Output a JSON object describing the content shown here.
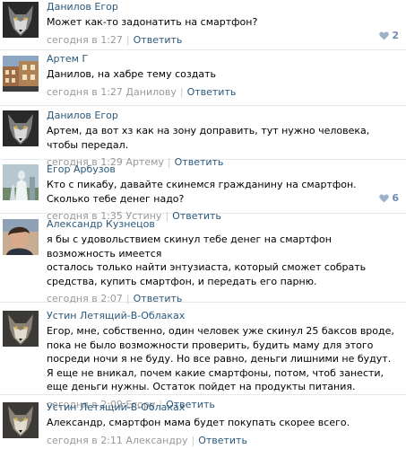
{
  "colors": {
    "link": "#2b587a",
    "meta": "#999999",
    "like": "#9db1c8",
    "divider": "#e7e8ec"
  },
  "comments": [
    {
      "author": "Данилов Егор",
      "avatar": "wolf-avatar",
      "lines": [
        "Может как-то задонатить на смартфон?"
      ],
      "time": "сегодня в 1:27",
      "reply_to": "",
      "reply_label": "Ответить",
      "likes": "2"
    },
    {
      "author": "Артем Г",
      "avatar": "building-avatar",
      "lines": [
        "Данилов, на хабре тему создать"
      ],
      "time": "сегодня в 1:27",
      "reply_to": "Данилову",
      "reply_label": "Ответить",
      "likes": ""
    },
    {
      "author": "Данилов Егор",
      "avatar": "wolf-avatar",
      "lines": [
        "Артем, да вот хз как на зону доправить, тут нужно человека, чтобы передал."
      ],
      "time": "сегодня в 1:29",
      "reply_to": "Артему",
      "reply_label": "Ответить",
      "likes": ""
    },
    {
      "author": "Егор Арбузов",
      "avatar": "statue-avatar",
      "lines": [
        "Кто с пикабу, давайте скинемся гражданину на смартфон. Сколько тебе денег надо?"
      ],
      "time": "сегодня в 1:35",
      "reply_to": "Устину",
      "reply_label": "Ответить",
      "likes": "6"
    },
    {
      "author": "Александр Кузнецов",
      "avatar": "person-avatar",
      "lines": [
        "я бы с удовольствием скинул тебе денег на смартфон",
        "возможность имеется",
        "осталось только найти энтузиаста, который сможет собрать средства, купить смартфон, и передать его парню."
      ],
      "time": "сегодня в 2:07",
      "reply_to": "",
      "reply_label": "Ответить",
      "likes": ""
    },
    {
      "author": "Устин Летящий-В-Облаках",
      "avatar": "wolf-avatar",
      "lines": [
        "Егор, мне, собственно, один человек уже скинул 25 баксов вроде, пока не было возможности проверить, будить маму для этого посреди ночи я не буду. Но все равно, деньги лишними не будут. Я еще не вникал, почем какие смартфоны, потом, чтоб занести, еще деньги нужны. Остаток пойдет на продукты питания."
      ],
      "time": "сегодня в 2:09",
      "reply_to": "Егору",
      "reply_label": "Ответить",
      "likes": ""
    },
    {
      "author": "Устин Летящий-В-Облаках",
      "avatar": "wolf-avatar",
      "lines": [
        "Александр, смартфон мама будет покупать скорее всего."
      ],
      "time": "сегодня в 2:11",
      "reply_to": "Александру",
      "reply_label": "Ответить",
      "likes": ""
    }
  ]
}
